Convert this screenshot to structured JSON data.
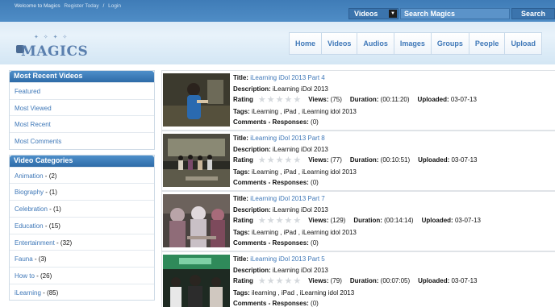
{
  "header": {
    "welcome": "Welcome to Magics",
    "register": "Register Today",
    "separator": "/",
    "login": "Login",
    "search_type": "Videos",
    "search_placeholder": "Search Magics",
    "search_button": "Search",
    "logo_text": "MAGICS"
  },
  "nav": [
    "Home",
    "Videos",
    "Audios",
    "Images",
    "Groups",
    "People",
    "Upload"
  ],
  "sidebar": {
    "recent_title": "Most Recent Videos",
    "recent_items": [
      "Featured",
      "Most Viewed",
      "Most Recent",
      "Most Comments"
    ],
    "categories_title": "Video Categories",
    "categories": [
      {
        "name": "Animation",
        "count": " - (2)"
      },
      {
        "name": "Biography",
        "count": " - (1)"
      },
      {
        "name": "Celebration",
        "count": " - (1)"
      },
      {
        "name": "Education",
        "count": " - (15)"
      },
      {
        "name": "Entertainment",
        "count": " - (32)"
      },
      {
        "name": "Fauna",
        "count": " - (3)"
      },
      {
        "name": "How to",
        "count": " - (26)"
      },
      {
        "name": "iLearning",
        "count": " - (85)"
      }
    ]
  },
  "labels": {
    "title": "Title:",
    "description": "Description:",
    "rating": "Rating",
    "views": "Views:",
    "duration": "Duration:",
    "uploaded": "Uploaded:",
    "tags": "Tags:",
    "comments": "Comments",
    "responses": "- Responses:"
  },
  "videos": [
    {
      "title": "iLearning iDol 2013 Part 4",
      "description": "iLearning iDol 2013",
      "views": "(75)",
      "duration": "(00:11:20)",
      "uploaded": "03-07-13",
      "tags": "iLearning , iPad , iLearning idol 2013",
      "responses": "(0)",
      "stars": 0
    },
    {
      "title": "iLearning iDol 2013 Part 8",
      "description": "iLearning iDol 2013",
      "views": "(77)",
      "duration": "(00:10:51)",
      "uploaded": "03-07-13",
      "tags": "iLearning , iPad , iLearning idol 2013",
      "responses": "(0)",
      "stars": 0
    },
    {
      "title": "iLearning iDol 2013 Part 7",
      "description": "iLearning iDol 2013",
      "views": "(129)",
      "duration": "(00:14:14)",
      "uploaded": "03-07-13",
      "tags": "iLearning , iPad , iLearning idol 2013",
      "responses": "(0)",
      "stars": 0
    },
    {
      "title": "iLearning iDol 2013 Part 5",
      "description": "iLearning iDol 2013",
      "views": "(79)",
      "duration": "(00:07:05)",
      "uploaded": "03-07-13",
      "tags": "ilearning , iPad , iLearning idol 2013",
      "responses": "(0)",
      "stars": 0
    }
  ],
  "colors": {
    "header_bar": "#4f8dc6",
    "link": "#3f78b8",
    "panel_title": "#2e6ba8"
  }
}
